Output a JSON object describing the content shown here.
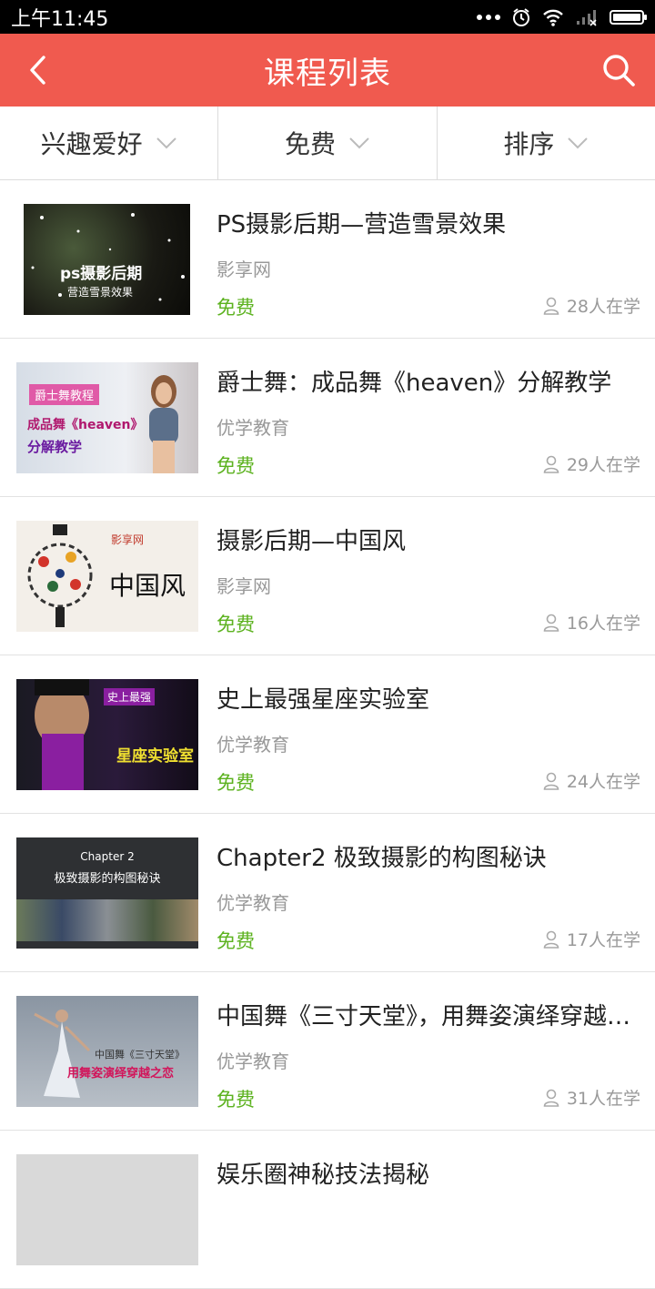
{
  "status_bar": {
    "time": "上午11:45"
  },
  "header": {
    "title": "课程列表",
    "back_icon": "back-icon",
    "search_icon": "search-icon"
  },
  "filters": [
    {
      "label": "兴趣爱好"
    },
    {
      "label": "免费"
    },
    {
      "label": "排序"
    }
  ],
  "courses": [
    {
      "title": "PS摄影后期—营造雪景效果",
      "source": "影享网",
      "price": "免费",
      "students": "28人在学",
      "thumb": {
        "line1": "ps摄影后期",
        "line2": "营造雪景效果"
      }
    },
    {
      "title": "爵士舞：成品舞《heaven》分解教学",
      "source": "优学教育",
      "price": "免费",
      "students": "29人在学",
      "thumb": {
        "tag": "爵士舞教程",
        "line1": "成品舞《heaven》",
        "line2": "分解教学"
      }
    },
    {
      "title": "摄影后期—中国风",
      "source": "影享网",
      "price": "免费",
      "students": "16人在学",
      "thumb": {
        "line1": "影享网",
        "line2": "中国风"
      }
    },
    {
      "title": "史上最强星座实验室",
      "source": "优学教育",
      "price": "免费",
      "students": "24人在学",
      "thumb": {
        "line1": "史上最强",
        "line2": "星座实验室"
      }
    },
    {
      "title": "Chapter2 极致摄影的构图秘诀",
      "source": "优学教育",
      "price": "免费",
      "students": "17人在学",
      "thumb": {
        "line1": "Chapter 2",
        "line2": "极致摄影的构图秘诀"
      }
    },
    {
      "title": "中国舞《三寸天堂》，用舞姿演绎穿越之恋",
      "source": "优学教育",
      "price": "免费",
      "students": "31人在学",
      "thumb": {
        "line1": "中国舞《三寸天堂》",
        "line2": "用舞姿演绎穿越之恋"
      }
    },
    {
      "title": "娱乐圈神秘技法揭秘",
      "source": "",
      "price": "",
      "students": "",
      "thumb": {}
    }
  ],
  "colors": {
    "accent": "#f05a4f",
    "free": "#5cb21f"
  }
}
